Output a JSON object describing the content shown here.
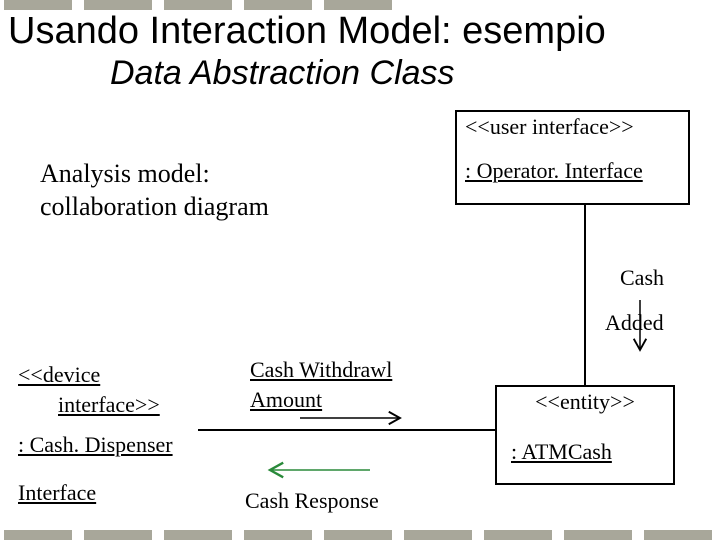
{
  "header": {
    "title": "Usando Interaction Model: esempio",
    "subtitle": "Data Abstraction Class"
  },
  "note": {
    "line1": "Analysis model:",
    "line2": "collaboration diagram"
  },
  "boxes": {
    "ui": {
      "stereo": "<<user interface>>",
      "name": ": Operator. Interface"
    },
    "device": {
      "stereo": "<<device",
      "stereo_line2": "interface>>",
      "name": ": Cash. Dispenser",
      "name2": "Interface"
    },
    "entity": {
      "stereo": "<<entity>>",
      "name": ": ATMCash"
    }
  },
  "messages": {
    "cash": "Cash",
    "added": "Added",
    "withdrawl_line1": "Cash Withdrawl",
    "withdrawl_line2": "Amount",
    "response": "Cash Response"
  }
}
